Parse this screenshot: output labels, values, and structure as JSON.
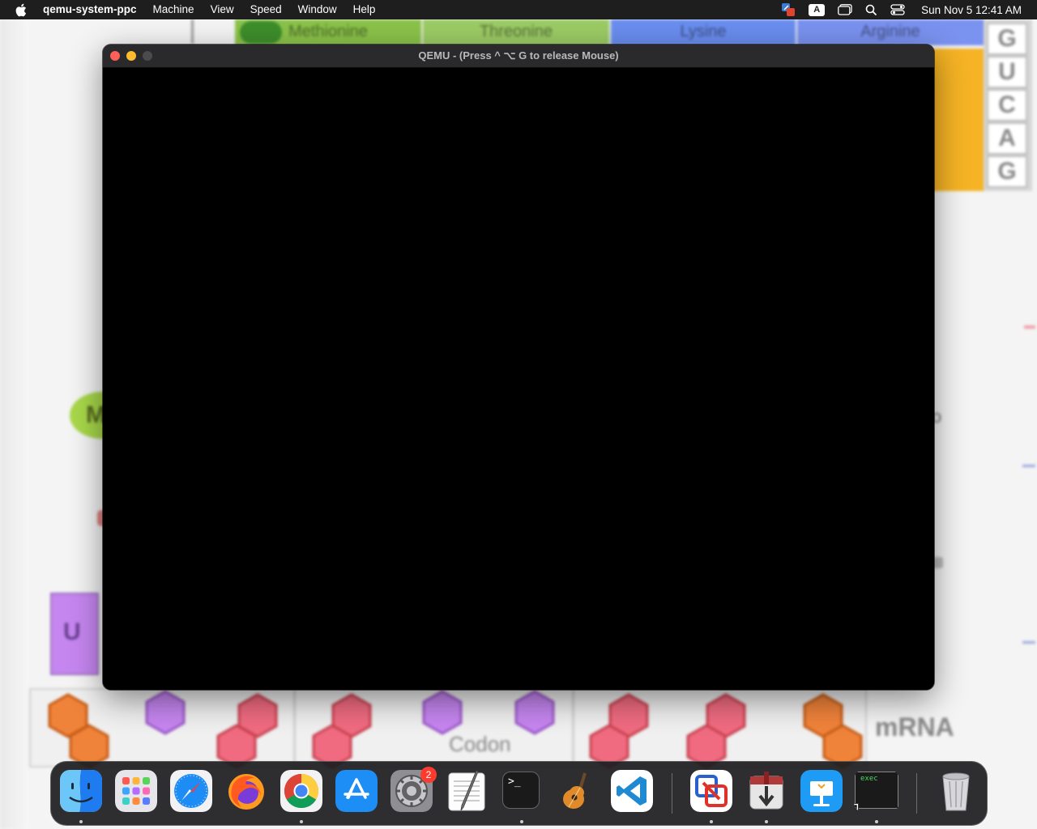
{
  "menubar": {
    "app_name": "qemu-system-ppc",
    "menus": [
      "Machine",
      "View",
      "Speed",
      "Window",
      "Help"
    ],
    "status_icons": [
      "keyboard-switch-icon",
      "input-source-a-icon",
      "screen-mirroring-icon",
      "search-icon",
      "control-center-icon"
    ],
    "input_source_label": "A",
    "clock": "Sun Nov 5  12:41 AM"
  },
  "background": {
    "amino_acids": [
      "Methionine",
      "Threonine",
      "Lysine",
      "Arginine"
    ],
    "bases": [
      "G",
      "U",
      "C",
      "A",
      "G"
    ],
    "fragment_m": "M",
    "u_block": "U",
    "codon_label": "Codon",
    "mrna_label": "mRNA",
    "colors": {
      "methionine": "#8bc34a",
      "threonine": "#9ccc65",
      "lysine": "#6a8ef0",
      "arginine": "#7a92f0",
      "orange": "#f5b325",
      "purple": "#c686f0",
      "pink": "#f06b80",
      "orange_hex": "#f0833a"
    }
  },
  "qemu_window": {
    "title": "QEMU - (Press  ^ ⌥ G  to release Mouse)",
    "screen_color": "#000000"
  },
  "dock": {
    "apps": [
      {
        "name": "Finder",
        "running": true
      },
      {
        "name": "Launchpad",
        "running": false
      },
      {
        "name": "Safari",
        "running": false
      },
      {
        "name": "Firefox",
        "running": false
      },
      {
        "name": "Google Chrome",
        "running": true
      },
      {
        "name": "App Store",
        "running": false
      },
      {
        "name": "System Settings",
        "running": false,
        "badge": "2"
      },
      {
        "name": "TextEdit",
        "running": false
      },
      {
        "name": "Terminal",
        "running": true
      },
      {
        "name": "GarageBand",
        "running": false
      },
      {
        "name": "Visual Studio Code",
        "running": false
      },
      {
        "name": "Parallels",
        "running": true
      },
      {
        "name": "Installer",
        "running": true
      },
      {
        "name": "Keynote",
        "running": false
      },
      {
        "name": "exec",
        "running": true
      }
    ],
    "terminal_prompt": ">_",
    "exec_label": "exec",
    "trash": "Trash"
  }
}
